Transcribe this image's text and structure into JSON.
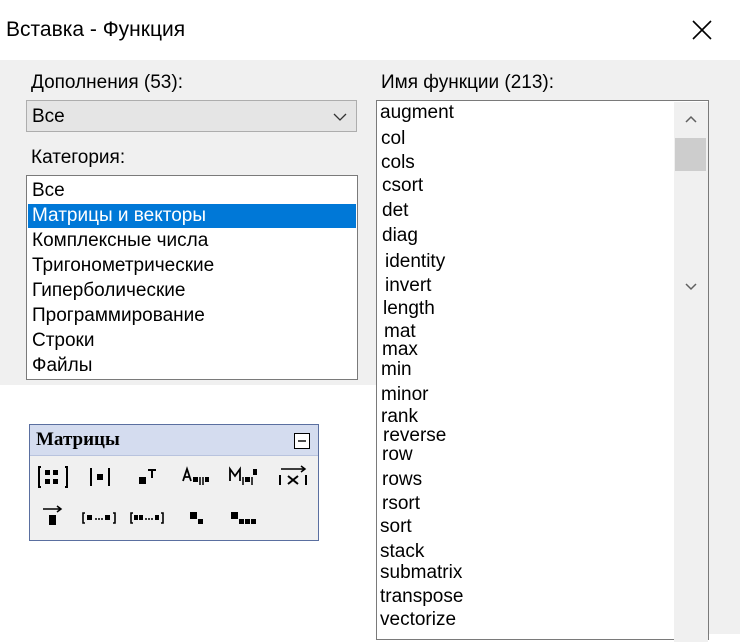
{
  "window": {
    "title": "Вставка - Функция"
  },
  "addons": {
    "label": "Дополнения (53):",
    "value": "Все"
  },
  "category": {
    "label": "Категория:",
    "items": [
      "Все",
      "Матрицы и векторы",
      "Комплексные числа",
      "Тригонометрические",
      "Гиперболические",
      "Программирование",
      "Строки",
      "Файлы"
    ],
    "selected": "Матрицы и векторы"
  },
  "functions": {
    "label": "Имя функции (213):",
    "items": [
      "augment",
      "col",
      "cols",
      "csort",
      "det",
      "diag",
      "identity",
      "invert",
      "length",
      "mat",
      "max",
      "min",
      "minor",
      "rank",
      "reverse",
      "row",
      "rows",
      "rsort",
      "sort",
      "stack",
      "submatrix",
      "transpose",
      "vectorize"
    ]
  },
  "toolbar": {
    "title": "Матрицы",
    "buttons_row1": [
      "matrix-icon",
      "determinant-icon",
      "transpose-icon",
      "column-icon",
      "inverse-icon",
      "cross-product-icon"
    ],
    "buttons_row2": [
      "vectorize-icon",
      "range-icon",
      "range-step-icon",
      "element-icon",
      "elements-icon"
    ],
    "accent": "#d4dcef"
  },
  "colors": {
    "selection": "#0078d7",
    "dialog_bg": "#f0f0f0"
  }
}
